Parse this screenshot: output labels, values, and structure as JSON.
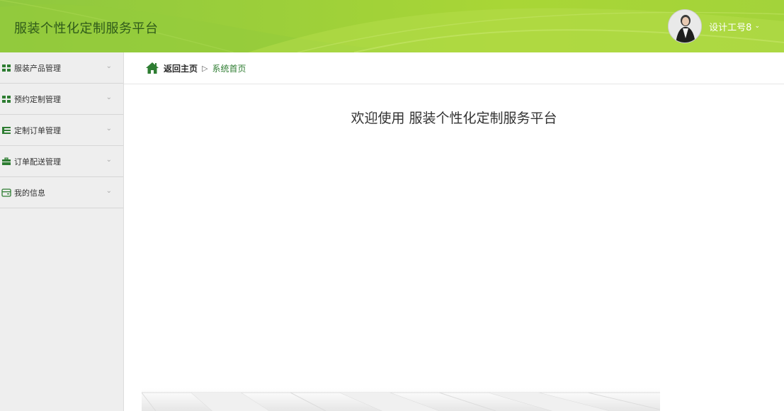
{
  "header": {
    "title": "服装个性化定制服务平台",
    "user_name": "设计工号8",
    "accent": "#9ccf3a"
  },
  "sidebar": {
    "items": [
      {
        "label": "服装产品管理",
        "icon": "grid-icon"
      },
      {
        "label": "预约定制管理",
        "icon": "grid-icon"
      },
      {
        "label": "定制订单管理",
        "icon": "list-icon"
      },
      {
        "label": "订单配送管理",
        "icon": "briefcase-icon"
      },
      {
        "label": "我的信息",
        "icon": "card-icon"
      }
    ]
  },
  "breadcrumb": {
    "home": "返回主页",
    "separator": "▷",
    "current": "系统首页"
  },
  "main": {
    "welcome": "欢迎使用 服装个性化定制服务平台"
  }
}
